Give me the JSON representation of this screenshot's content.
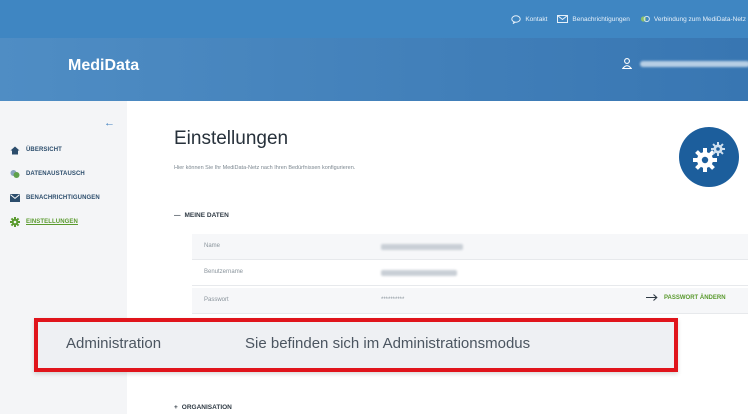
{
  "topbar": {
    "links": [
      {
        "label": "Kontakt",
        "icon": "chat-bubble-icon"
      },
      {
        "label": "Benachrichtigungen",
        "icon": "envelope-icon"
      },
      {
        "label": "Verbindung zum MediData-Netz",
        "icon": "connection-icon"
      }
    ]
  },
  "header": {
    "brand": "MediData",
    "user_icon": "user-icon"
  },
  "sidebar": {
    "collapse_icon": "arrow-left-icon",
    "items": [
      {
        "label": "ÜBERSICHT",
        "icon": "home-icon",
        "active": false
      },
      {
        "label": "DATENAUSTAUSCH",
        "icon": "exchange-icon",
        "active": false
      },
      {
        "label": "BENACHRICHTIGUNGEN",
        "icon": "envelope-icon",
        "active": false
      },
      {
        "label": "EINSTELLUNGEN",
        "icon": "gear-icon",
        "active": true
      }
    ]
  },
  "main": {
    "title": "Einstellungen",
    "description": "Hier können Sie Ihr MediData-Netz nach Ihren Bedürfnissen konfigurieren.",
    "settings_icon": "gears-icon",
    "section_mydata": {
      "toggle": "—",
      "label": "MEINE DATEN"
    },
    "rows": [
      {
        "label": "Name"
      },
      {
        "label": "Benutzername"
      },
      {
        "label": "Passwort",
        "value": "**********"
      }
    ],
    "password_change": {
      "label": "PASSWORT ÄNDERN",
      "icon": "arrow-right-icon"
    },
    "section_org": {
      "toggle": "+",
      "label": "ORGANISATION"
    }
  },
  "banner": {
    "label": "Administration",
    "message": "Sie befinden sich im Administrationsmodus",
    "border_color": "#e0141b"
  },
  "colors": {
    "topbar": "#3f86c2",
    "header": "#3876b2",
    "accent_green": "#5a9a2e",
    "gear_circle": "#1c5e9c"
  }
}
